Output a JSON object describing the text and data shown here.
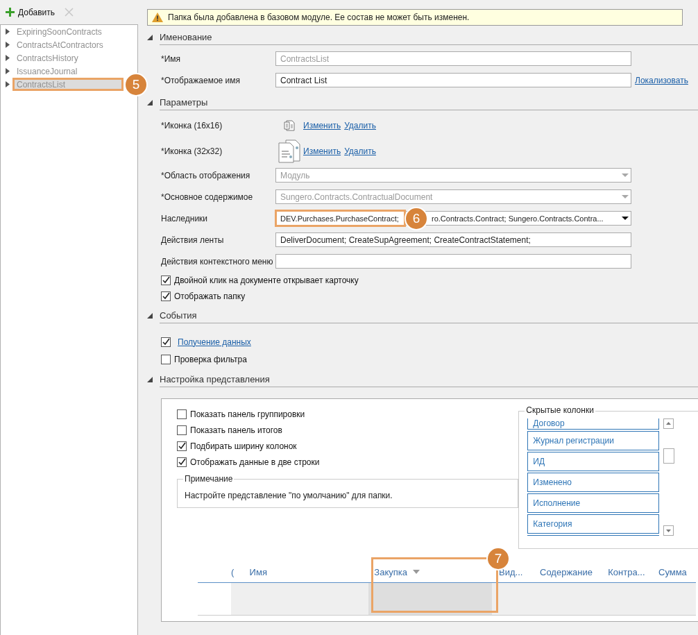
{
  "toolbar": {
    "add_label": "Добавить"
  },
  "tree": {
    "items": [
      {
        "label": "ExpiringSoonContracts",
        "selected": false
      },
      {
        "label": "ContractsAtContractors",
        "selected": false
      },
      {
        "label": "ContractsHistory",
        "selected": false
      },
      {
        "label": "IssuanceJournal",
        "selected": false
      },
      {
        "label": "ContractsList",
        "selected": true,
        "callout": "5"
      }
    ]
  },
  "notice": "Папка была добавлена в базовом модуле. Ее состав не может быть изменен.",
  "sections": [
    {
      "title": "Именование",
      "rows": [
        {
          "kind": "input",
          "label": "*Имя",
          "value": "ContractsList",
          "disabled": true
        },
        {
          "kind": "input",
          "label": "*Отображаемое имя",
          "value": "Contract List",
          "disabled": false,
          "link": "Локализовать"
        }
      ]
    },
    {
      "title": "Параметры",
      "rows": [
        {
          "kind": "icon16",
          "label": "*Иконка (16x16)",
          "links": [
            "Изменить",
            "Удалить"
          ]
        },
        {
          "kind": "icon32",
          "label": "*Иконка (32x32)",
          "links": [
            "Изменить",
            "Удалить"
          ]
        },
        {
          "kind": "select",
          "label": "*Область отображения",
          "value_parts": [
            "Модуль"
          ],
          "disabled": true
        },
        {
          "kind": "select",
          "label": "*Основное содержимое",
          "value_parts": [
            "Sungero.Contracts.ContractualDocument"
          ],
          "disabled": true
        },
        {
          "kind": "select",
          "label": "Наследники",
          "value_parts": [
            "DEV.Purchases.PurchaseContract;",
            "ro.Contracts.Contract; Sungero.Contracts.Contra..."
          ],
          "disabled": false,
          "callout": "6"
        },
        {
          "kind": "input",
          "label": "Действия ленты",
          "value": "DeliverDocument; CreateSupAgreement; CreateContractStatement;",
          "disabled": false
        },
        {
          "kind": "input",
          "label": "Действия контекстного меню"
        },
        {
          "kind": "check",
          "label": "Двойной клик на документе открывает карточку",
          "checked": true,
          "link": false
        },
        {
          "kind": "check",
          "label": "Отображать папку",
          "checked": true,
          "link": false
        }
      ]
    },
    {
      "title": "События",
      "rows": [
        {
          "kind": "check",
          "label": "Получение данных",
          "checked": true,
          "link": true
        },
        {
          "kind": "check",
          "label": "Проверка фильтра",
          "checked": false,
          "link": false
        }
      ]
    },
    {
      "title": "Настройка представления",
      "rows": [
        {
          "kind": "view",
          "checks": [
            {
              "label": "Показать панель группировки",
              "checked": false
            },
            {
              "label": "Показать панель итогов",
              "checked": false
            },
            {
              "label": "Подбирать ширину колонок",
              "checked": true
            },
            {
              "label": "Отображать данные в две строки",
              "checked": true
            }
          ],
          "note": {
            "title": "Примечание",
            "text": "Настройте представление \"по умолчанию\" для папки."
          },
          "hidden_columns": {
            "title": "Скрытые колонки",
            "items": [
              "Договор",
              "Журнал регистрации",
              "ИД",
              "Изменено",
              "Исполнение",
              "Категория"
            ]
          },
          "grid_columns": [
            {
              "label": "(",
              "sorted": false
            },
            {
              "label": "Имя",
              "sorted": false
            },
            {
              "label": "Закупка",
              "sorted": true,
              "callout": "7"
            },
            {
              "label": "Вид...",
              "sorted": false
            },
            {
              "label": "Содержание",
              "sorted": false
            },
            {
              "label": "Контра...",
              "sorted": false
            },
            {
              "label": "Сумма",
              "sorted": false
            }
          ]
        }
      ]
    }
  ]
}
